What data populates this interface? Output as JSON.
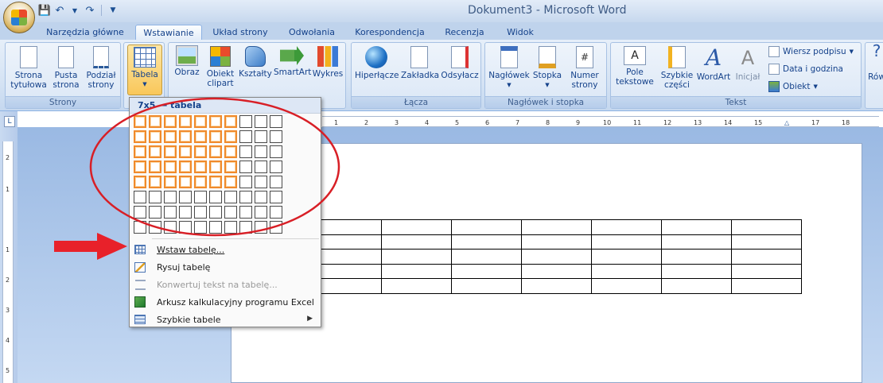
{
  "window": {
    "title": "Dokument3 - Microsoft Word"
  },
  "quick_access": {
    "save_icon": "save-icon",
    "undo_icon": "undo-icon",
    "redo_icon": "redo-icon"
  },
  "tabs": [
    {
      "label": "Narzędzia główne"
    },
    {
      "label": "Wstawianie",
      "active": true
    },
    {
      "label": "Układ strony"
    },
    {
      "label": "Odwołania"
    },
    {
      "label": "Korespondencja"
    },
    {
      "label": "Recenzja"
    },
    {
      "label": "Widok"
    }
  ],
  "ribbon": {
    "groups": {
      "strony": {
        "label": "Strony",
        "buttons": [
          "Strona tytułowa",
          "Pusta strona",
          "Podział strony"
        ]
      },
      "tabele": {
        "button": "Tabela"
      },
      "ilustracje": {
        "buttons": [
          "Obraz",
          "Obiekt clipart",
          "Kształty",
          "SmartArt",
          "Wykres"
        ]
      },
      "laczа": {
        "label": "Łącza",
        "buttons": [
          "Hiperłącze",
          "Zakładka",
          "Odsyłacz"
        ]
      },
      "naglowek": {
        "label": "Nagłówek i stopka",
        "buttons": [
          "Nagłówek",
          "Stopka",
          "Numer strony"
        ]
      },
      "tekst": {
        "label": "Tekst",
        "buttons": [
          "Pole tekstowe",
          "Szybkie części",
          "WordArt",
          "Inicjał"
        ],
        "small_items": [
          "Wiersz podpisu",
          "Data i godzina",
          "Obiekt"
        ]
      },
      "cut": {
        "button": "Rów"
      }
    }
  },
  "ruler": {
    "corner": "L",
    "numbers": [
      "1",
      "2",
      "3",
      "4",
      "5",
      "6",
      "7",
      "8",
      "9",
      "10",
      "11",
      "12",
      "13",
      "14",
      "15",
      "17",
      "18"
    ],
    "vertical_numbers": [
      "2",
      "1",
      "1",
      "2",
      "3",
      "4",
      "5"
    ]
  },
  "table_menu": {
    "header": "7x5 — tabela",
    "grid": {
      "columns": 10,
      "rows": 8,
      "selected_columns": 7,
      "selected_rows": 5
    },
    "items": [
      {
        "label": "Wstaw tabelę...",
        "icon": "insert-table-icon",
        "enabled": true
      },
      {
        "label": "Rysuj tabelę",
        "icon": "draw-table-icon",
        "enabled": true
      },
      {
        "label": "Konwertuj tekst na tabelę...",
        "icon": "convert-text-icon",
        "enabled": false
      },
      {
        "label": "Arkusz kalkulacyjny programu Excel",
        "icon": "excel-icon",
        "enabled": true
      },
      {
        "label": "Szybkie tabele",
        "icon": "quick-tables-icon",
        "enabled": true,
        "submenu": true
      }
    ]
  },
  "document": {
    "table": {
      "rows": 5,
      "columns": 7
    }
  },
  "annotation_colors": {
    "ellipse": "#d81f26",
    "arrow": "#e8212a",
    "selection": "#f08a2b"
  }
}
